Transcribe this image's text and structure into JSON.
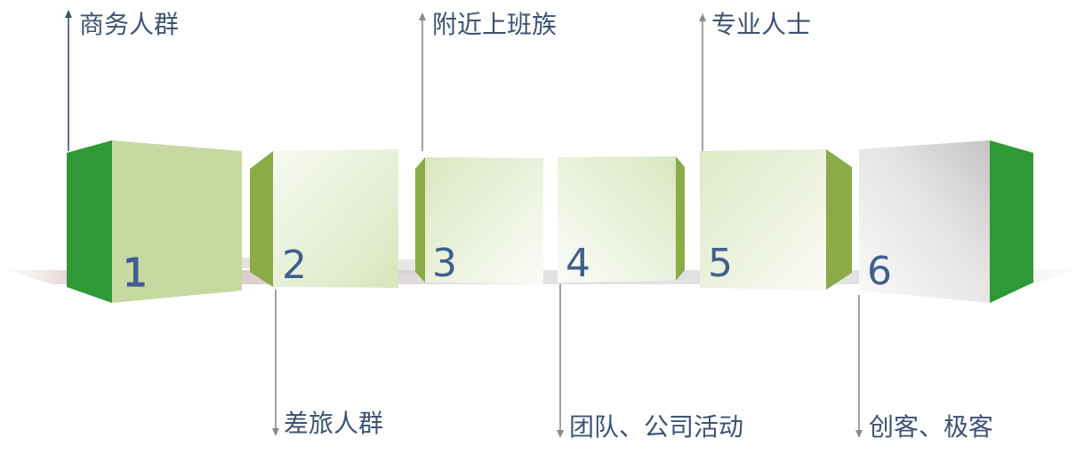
{
  "segments": [
    {
      "number": "1",
      "label": "商务人群"
    },
    {
      "number": "2",
      "label": "差旅人群"
    },
    {
      "number": "3",
      "label": "附近上班族"
    },
    {
      "number": "4",
      "label": "团队、公司活动"
    },
    {
      "number": "5",
      "label": "专业人士"
    },
    {
      "number": "6",
      "label": "创客、极客"
    }
  ],
  "colors": {
    "dark_green": "#2f9a35",
    "olive_green": "#8aab45",
    "pale_green": "#c7d9a0",
    "light_face_start": "#d8e6bd",
    "number_blue": "#3f5f8f",
    "label_text": "#3e5374",
    "arrow_gray": "#8a8a8a",
    "arrow_navy": "#3b4f6e"
  }
}
